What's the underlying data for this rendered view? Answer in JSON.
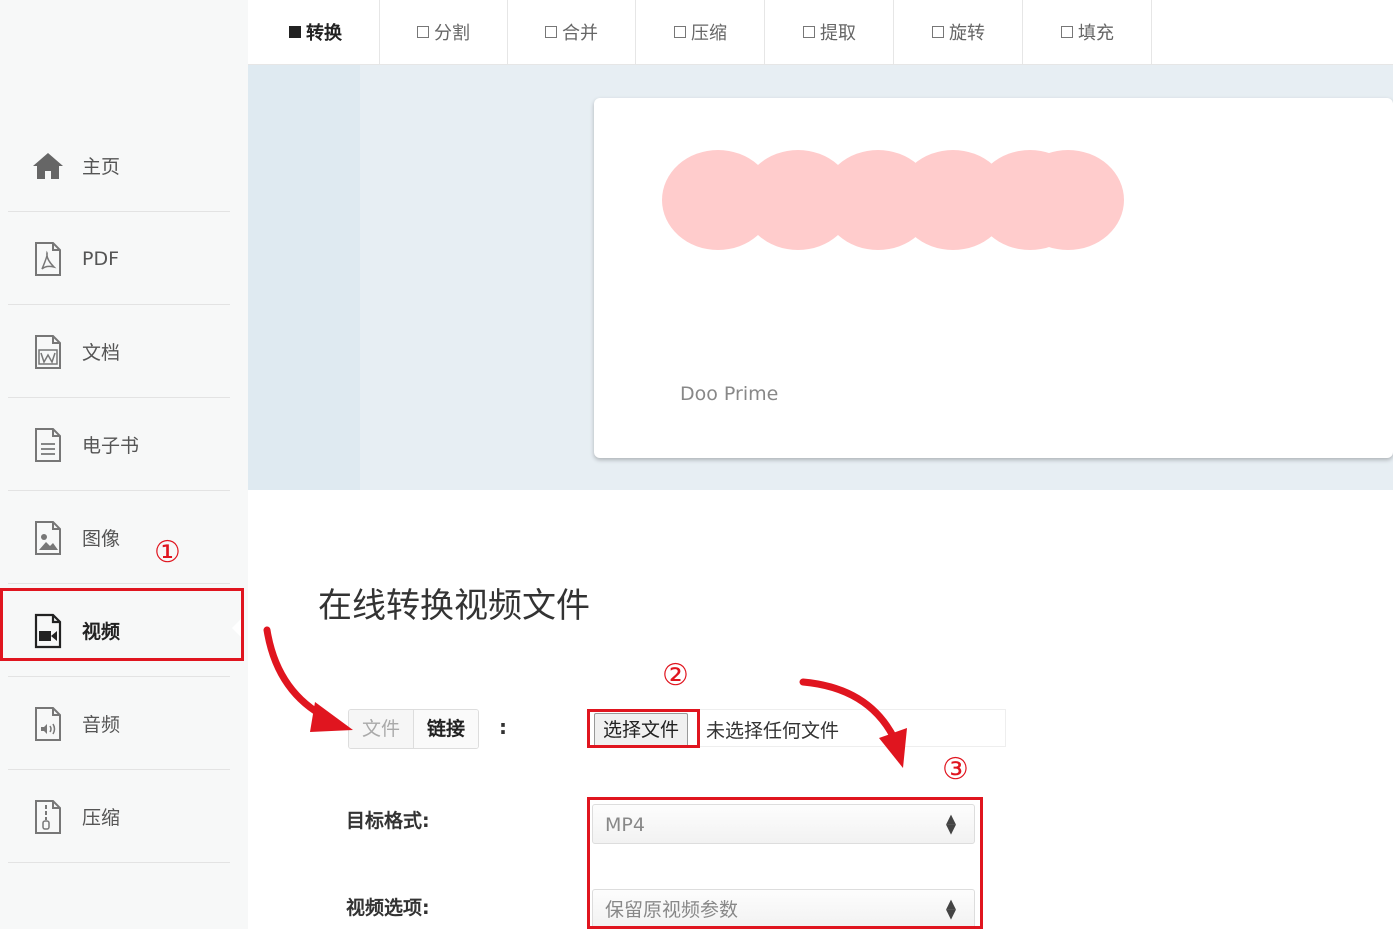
{
  "sidebar": {
    "items": [
      {
        "label": "主页",
        "icon": "home-icon"
      },
      {
        "label": "PDF",
        "icon": "pdf-file-icon"
      },
      {
        "label": "文档",
        "icon": "word-file-icon"
      },
      {
        "label": "电子书",
        "icon": "ebook-file-icon"
      },
      {
        "label": "图像",
        "icon": "image-file-icon"
      },
      {
        "label": "视频",
        "icon": "video-file-icon",
        "active": true
      },
      {
        "label": "音频",
        "icon": "audio-file-icon"
      },
      {
        "label": "压缩",
        "icon": "zip-file-icon"
      }
    ]
  },
  "tabs": [
    "转换",
    "分割",
    "合并",
    "压缩",
    "提取",
    "旋转",
    "填充"
  ],
  "active_tab": "转换",
  "ad": {
    "sponsor": "Doo Prime"
  },
  "main": {
    "title": "在线转换视频文件",
    "mode": {
      "file": "文件",
      "link": "链接",
      "colon": ":"
    },
    "file_button": "选择文件",
    "file_status": "未选择任何文件",
    "target_format": {
      "label": "目标格式:",
      "value": "MP4"
    },
    "video_options": {
      "label": "视频选项:",
      "value": "保留原视频参数"
    }
  },
  "annotations": {
    "step1": "①",
    "step2": "②",
    "step3": "③"
  },
  "colors": {
    "highlight": "#e0151f",
    "blur": "#ffcccc"
  }
}
